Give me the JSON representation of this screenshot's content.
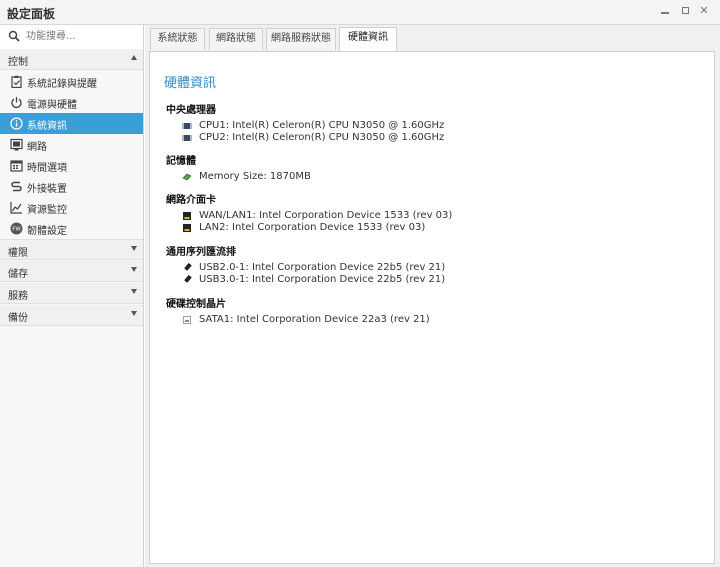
{
  "window": {
    "title": "設定面板"
  },
  "sidebar": {
    "search_placeholder": "功能搜尋...",
    "groups": [
      {
        "label": "控制",
        "expanded": true
      },
      {
        "label": "權限",
        "expanded": false
      },
      {
        "label": "儲存",
        "expanded": false
      },
      {
        "label": "服務",
        "expanded": false
      },
      {
        "label": "備份",
        "expanded": false
      }
    ],
    "items": [
      {
        "label": "系統記錄與提醒",
        "icon": "clipboard-check-icon"
      },
      {
        "label": "電源與硬體",
        "icon": "power-icon"
      },
      {
        "label": "系統資訊",
        "icon": "info-icon",
        "active": true
      },
      {
        "label": "網路",
        "icon": "network-icon"
      },
      {
        "label": "時間選項",
        "icon": "calendar-icon"
      },
      {
        "label": "外接裝置",
        "icon": "usb-device-icon"
      },
      {
        "label": "資源監控",
        "icon": "chart-icon"
      },
      {
        "label": "韌體設定",
        "icon": "firmware-icon"
      }
    ]
  },
  "tabs": [
    {
      "label": "系統狀態"
    },
    {
      "label": "網路狀態"
    },
    {
      "label": "網路服務狀態"
    },
    {
      "label": "硬體資訊",
      "active": true
    }
  ],
  "content": {
    "title": "硬體資訊",
    "sections": [
      {
        "title": "中央處理器",
        "items": [
          {
            "icon": "cpu-icon",
            "text": "CPU1: Intel(R) Celeron(R) CPU N3050 @ 1.60GHz"
          },
          {
            "icon": "cpu-icon",
            "text": "CPU2: Intel(R) Celeron(R) CPU N3050 @ 1.60GHz"
          }
        ]
      },
      {
        "title": "記憶體",
        "items": [
          {
            "icon": "memory-icon",
            "text": "Memory Size: 1870MB"
          }
        ]
      },
      {
        "title": "網路介面卡",
        "items": [
          {
            "icon": "ethernet-icon",
            "text": "WAN/LAN1: Intel Corporation Device 1533 (rev 03)"
          },
          {
            "icon": "ethernet-icon",
            "text": "LAN2: Intel Corporation Device 1533 (rev 03)"
          }
        ]
      },
      {
        "title": "通用序列匯流排",
        "items": [
          {
            "icon": "usb-icon",
            "text": "USB2.0-1: Intel Corporation Device 22b5 (rev 21)"
          },
          {
            "icon": "usb-icon",
            "text": "USB3.0-1: Intel Corporation Device 22b5 (rev 21)"
          }
        ]
      },
      {
        "title": "硬碟控制晶片",
        "items": [
          {
            "icon": "disk-controller-icon",
            "text": "SATA1: Intel Corporation Device 22a3 (rev 21)"
          }
        ]
      }
    ]
  },
  "colors": {
    "accent": "#3a9fd6",
    "title_blue": "#2f8ec8"
  }
}
